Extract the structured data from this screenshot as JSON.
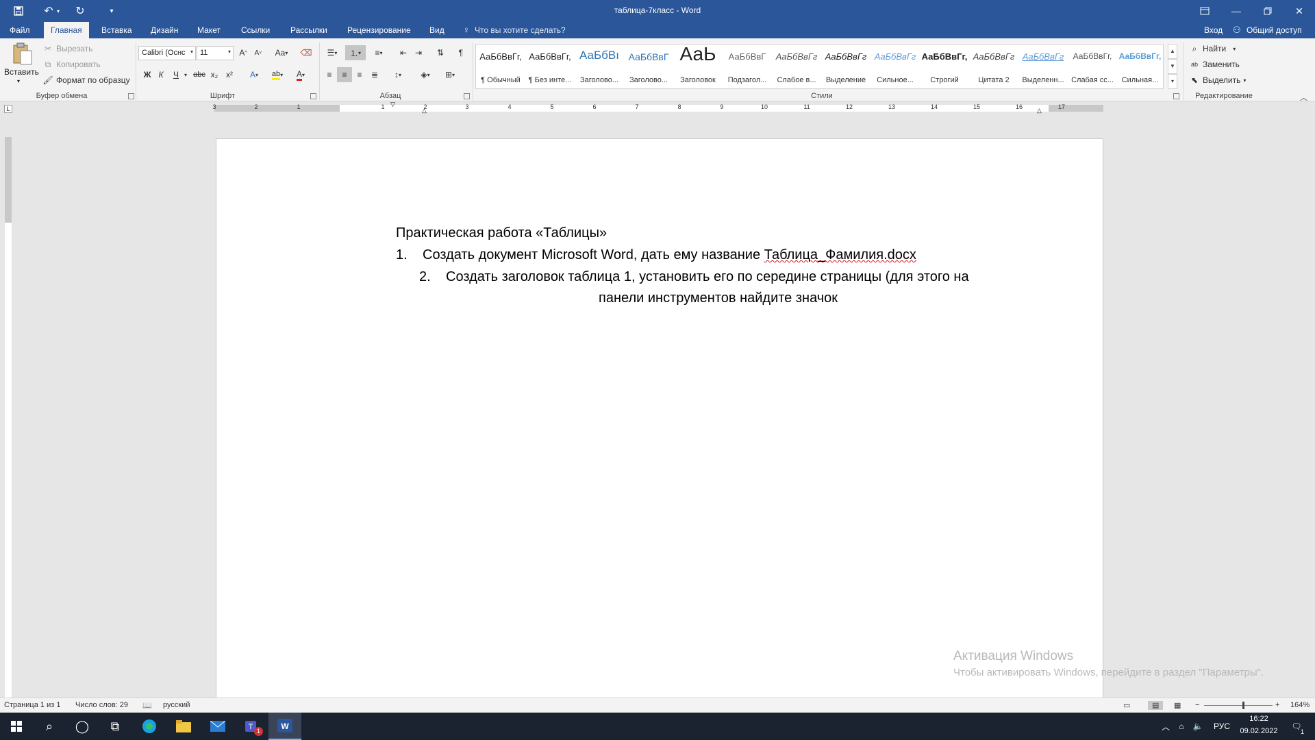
{
  "window": {
    "title": "таблица-7класс - Word",
    "login": "Вход",
    "share": "Общий доступ"
  },
  "tabs": [
    "Файл",
    "Главная",
    "Вставка",
    "Дизайн",
    "Макет",
    "Ссылки",
    "Рассылки",
    "Рецензирование",
    "Вид"
  ],
  "active_tab": "Главная",
  "tell_me_placeholder": "Что вы хотите сделать?",
  "clipboard": {
    "paste": "Вставить",
    "cut": "Вырезать",
    "copy": "Копировать",
    "format_painter": "Формат по образцу",
    "label": "Буфер обмена"
  },
  "font": {
    "family": "Calibri (Оснс",
    "size": "11",
    "label": "Шрифт",
    "bold": "Ж",
    "italic": "К",
    "underline": "Ч",
    "strike": "abc",
    "subscript": "x₂",
    "superscript": "x²",
    "grow": "A",
    "shrink": "A",
    "case": "Aa",
    "effects": "A",
    "highlight": "ab",
    "color": "A"
  },
  "paragraph": {
    "label": "Абзац"
  },
  "styles": {
    "label": "Стили",
    "items": [
      {
        "preview": "АаБбВвГг,",
        "name": "¶ Обычный"
      },
      {
        "preview": "АаБбВвГг,",
        "name": "¶ Без инте..."
      },
      {
        "preview": "АаБбВı",
        "name": "Заголово..."
      },
      {
        "preview": "АаБбВвГ",
        "name": "Заголово..."
      },
      {
        "preview": "АаЬ",
        "name": "Заголовок"
      },
      {
        "preview": "АаБбВвГ",
        "name": "Подзагол..."
      },
      {
        "preview": "АаБбВвГг",
        "name": "Слабое в..."
      },
      {
        "preview": "АаБбВвГг",
        "name": "Выделение"
      },
      {
        "preview": "АаБбВвГг",
        "name": "Сильное..."
      },
      {
        "preview": "АаБбВвГг,",
        "name": "Строгий"
      },
      {
        "preview": "АаБбВвГг",
        "name": "Цитата 2"
      },
      {
        "preview": "АаБбВвГг",
        "name": "Выделенн..."
      },
      {
        "preview": "АаБбВвГг,",
        "name": "Слабая сс..."
      },
      {
        "preview": "АаБбВвГг,",
        "name": "Сильная..."
      }
    ]
  },
  "editing": {
    "label": "Редактирование",
    "find": "Найти",
    "replace": "Заменить",
    "select": "Выделить"
  },
  "ruler": {
    "h_numbers": [
      "3",
      "2",
      "1",
      "1",
      "2",
      "3",
      "4",
      "5",
      "6",
      "7",
      "8",
      "9",
      "10",
      "11",
      "12",
      "13",
      "14",
      "15",
      "16",
      "17"
    ],
    "tab_selector": "L"
  },
  "document": {
    "title": "Практическая работа «Таблицы»",
    "item1_num": "1.",
    "item1_text": "Создать документ Microsoft Word, дать ему название ",
    "item1_file": "Таблица_Фамилия.docx",
    "item2_num": "2.",
    "item2_line1": "Создать заголовок таблица 1, установить его по середине страницы (для этого на",
    "item2_line2": "панели инструментов найдите значок"
  },
  "watermark": {
    "line1": "Активация Windows",
    "line2": "Чтобы активировать Windows, перейдите в раздел \"Параметры\"."
  },
  "status": {
    "page": "Страница 1 из 1",
    "words": "Число слов: 29",
    "language": "русский",
    "zoom": "164%"
  },
  "taskbar": {
    "lang": "РУС",
    "time": "16:22",
    "date": "09.02.2022",
    "teams_badge": "1",
    "notif_badge": "1"
  },
  "colors": {
    "accent": "#2b579a",
    "ribbon": "#f3f3f3",
    "taskbar": "#1b2330"
  }
}
